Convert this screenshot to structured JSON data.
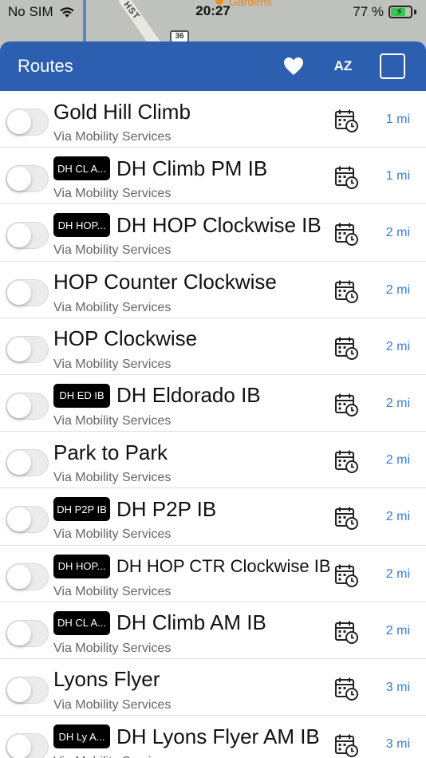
{
  "status_bar": {
    "carrier": "No SIM",
    "time": "20:27",
    "battery": "77 %",
    "battery_level": 0.77
  },
  "map": {
    "street_label": "HST",
    "route_shield": "36",
    "poi_label": "Gardens"
  },
  "header": {
    "title": "Routes",
    "favorite_icon": "heart-icon",
    "sort_label": "AZ",
    "select_all_icon": "checkbox-icon"
  },
  "routes": [
    {
      "badge": "",
      "name": "Gold Hill Climb",
      "agency": "Via Mobility Services",
      "distance": "1 mi"
    },
    {
      "badge": "DH CL A...",
      "name": "DH Climb PM IB",
      "agency": "Via Mobility Services",
      "distance": "1 mi"
    },
    {
      "badge": "DH HOP...",
      "name": "DH HOP Clockwise IB",
      "agency": "Via Mobility Services",
      "distance": "2 mi"
    },
    {
      "badge": "",
      "name": "HOP Counter Clockwise",
      "agency": "Via Mobility Services",
      "distance": "2 mi"
    },
    {
      "badge": "",
      "name": "HOP Clockwise",
      "agency": "Via Mobility Services",
      "distance": "2 mi"
    },
    {
      "badge": "DH ED IB",
      "name": "DH Eldorado IB",
      "agency": "Via Mobility Services",
      "distance": "2 mi"
    },
    {
      "badge": "",
      "name": "Park to Park",
      "agency": "Via Mobility Services",
      "distance": "2 mi"
    },
    {
      "badge": "DH P2P IB",
      "name": "DH P2P IB",
      "agency": "Via Mobility Services",
      "distance": "2 mi"
    },
    {
      "badge": "DH HOP...",
      "name": "DH HOP CTR Clockwise IB",
      "agency": "Via Mobility Services",
      "distance": "2 mi"
    },
    {
      "badge": "DH CL A...",
      "name": "DH Climb AM IB",
      "agency": "Via Mobility Services",
      "distance": "2 mi"
    },
    {
      "badge": "",
      "name": "Lyons Flyer",
      "agency": "Via Mobility Services",
      "distance": "3 mi"
    },
    {
      "badge": "DH Ly A...",
      "name": "DH Lyons Flyer AM IB",
      "agency": "Via Mobility Services",
      "distance": "3 mi"
    }
  ],
  "colors": {
    "header": "#2d5fb0",
    "distance": "#2f7fe0",
    "badge": "#000000"
  }
}
